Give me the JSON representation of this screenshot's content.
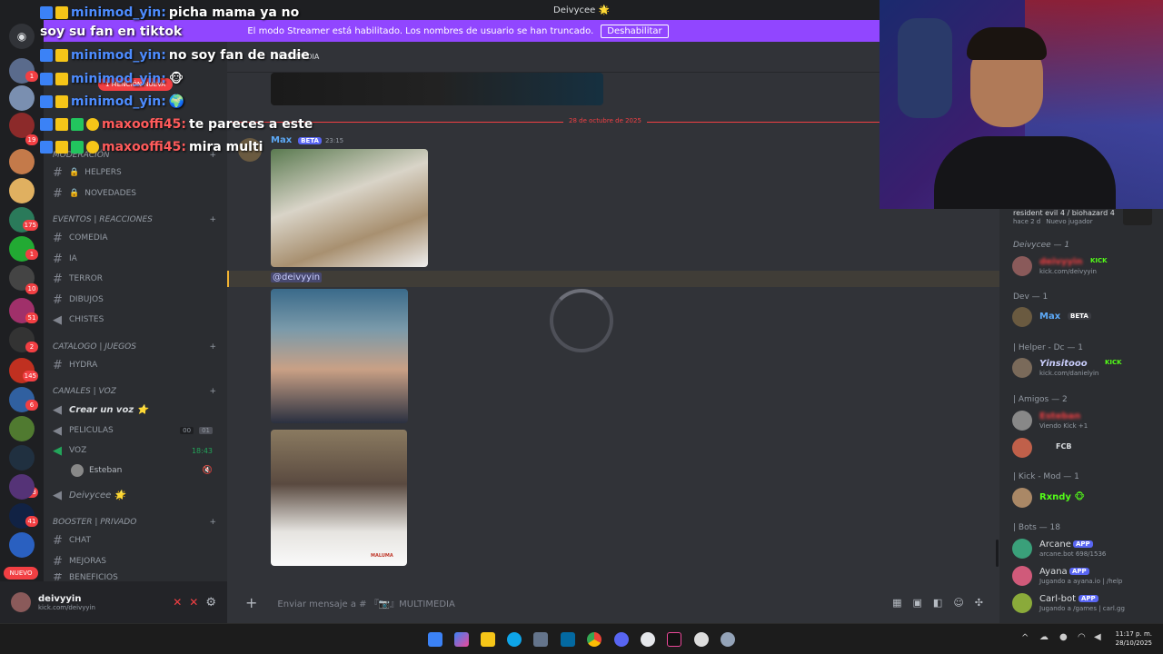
{
  "window": {
    "title": "Deivycee 🌟"
  },
  "banner": {
    "text": "El modo Streamer está habilitado. Los nombres de usuario se han truncado.",
    "button": "Deshabilitar"
  },
  "server_badges": [
    "1",
    "19",
    "175",
    "1",
    "10",
    "51",
    "2",
    "145",
    "6",
    "603",
    "41",
    "NUEVO"
  ],
  "sidebar": {
    "categories": [
      {
        "label": "MODERACIÓN"
      },
      {
        "label": "EVENTOS | REACCIONES"
      },
      {
        "label": "CATALOGO | JUEGOS"
      },
      {
        "label": "CANALES | VOZ"
      },
      {
        "label": "BOOSTER | PRIVADO"
      }
    ],
    "channels": {
      "helpers": "HELPERS",
      "novedades": "NOVEDADES",
      "comedia": "COMEDIA",
      "ia": "IA",
      "terror": "TERROR",
      "dibujos": "DIBUJOS",
      "chistes": "CHISTES",
      "hydra": "HYDRA",
      "crear_voz": "Crear un voz ⭐",
      "peliculas": "PELICULAS",
      "peliculas_counts": [
        "00",
        "01"
      ],
      "voz": "VOZ",
      "voz_time": "18:43",
      "voice_user": "Esteban",
      "deivycee": "Deivycee 🌟",
      "chat": "CHAT",
      "mejoras": "MEJORAS",
      "beneficios": "BENEFICIOS",
      "mention_pill": "1 MENCIÓN NUEVA"
    }
  },
  "user": {
    "name": "deivyyin",
    "status": "kick.com/deivyyin"
  },
  "chat": {
    "channel": "MULTIMEDIA",
    "date_divider": "28 de octubre de 2025",
    "author": "Max",
    "author_tag": "BETA",
    "time": "23:15",
    "mention": "@deivyyin",
    "composer_placeholder": "Enviar mensaje a # 『📷』MULTIMEDIA",
    "image_caption": "MALUMA"
  },
  "overlay_chat": [
    {
      "user": "minimod_yin:",
      "text": "picha mama ya no"
    },
    {
      "user": "",
      "text": "soy su fan en tiktok"
    },
    {
      "user": "minimod_yin:",
      "text": "no soy fan de nadie"
    },
    {
      "user": "minimod_yin:",
      "text": "🐵"
    },
    {
      "user": "minimod_yin:",
      "text": "🌍"
    },
    {
      "user": "maxooffi45:",
      "text": "te pareces a este"
    },
    {
      "user": "maxooffi45:",
      "text": "mira multi"
    }
  ],
  "stream": {
    "game": "resident evil 4 / biohazard 4",
    "meta1": "hace 2 d",
    "meta2": "Nuevo jugador"
  },
  "members": {
    "groups": [
      {
        "title": "Deivycee — 1"
      },
      {
        "title": "Dev — 1"
      },
      {
        "title": "| Helper - Dc — 1"
      },
      {
        "title": "| Amigos — 2"
      },
      {
        "title": "| Kick - Mod — 1"
      },
      {
        "title": "| Bots — 18"
      }
    ],
    "list": {
      "deivyyin": {
        "name": "deivyyin",
        "tag": "KICK",
        "sub": "kick.com/deivyyin"
      },
      "max": {
        "name": "Max",
        "tag": "BETA"
      },
      "yinsitooo": {
        "name": "Yinsitooo",
        "tag": "KICK",
        "sub": "kick.com/danielyin"
      },
      "esteban": {
        "name": "Esteban",
        "sub": "Viendo Kick +1"
      },
      "fcb": {
        "name": "FCB"
      },
      "rxndy": {
        "name": "Rxndy 🐵"
      },
      "arcane": {
        "name": "Arcane",
        "tag": "APP",
        "sub": "arcane.bot 698/1536"
      },
      "ayana": {
        "name": "Ayana",
        "tag": "APP",
        "sub": "Jugando a ayana.io | /help"
      },
      "carlbot": {
        "name": "Carl-bot",
        "tag": "APP",
        "sub": "Jugando a /games | carl.gg"
      }
    }
  },
  "taskbar": {
    "time": "11:17 p. m.",
    "date": "28/10/2025"
  },
  "colors": {
    "banner": "#9146ff",
    "accent": "#5865f2",
    "kick": "#53fc18",
    "mention": "#f23f43"
  }
}
